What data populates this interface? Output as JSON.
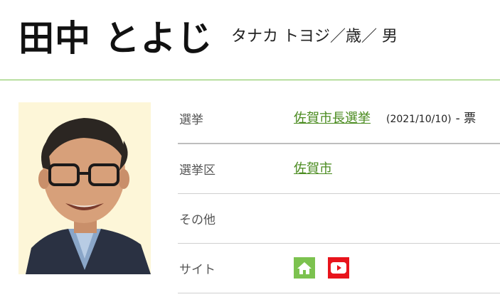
{
  "profile": {
    "name": "田中 とよじ",
    "kana_age_gender": "タナカ トヨジ／歳／ 男"
  },
  "details": {
    "election_label": "選挙",
    "election_name": "佐賀市長選挙",
    "election_date": "(2021/10/10)",
    "votes": "- 票",
    "district_label": "選挙区",
    "district_name": "佐賀市",
    "other_label": "その他",
    "other_value": "",
    "site_label": "サイト"
  },
  "icons": {
    "home": "home-icon",
    "youtube": "youtube-icon"
  },
  "colors": {
    "accent_green": "#7cc24f",
    "link_green": "#4a8b1f",
    "youtube_red": "#e8141c"
  }
}
